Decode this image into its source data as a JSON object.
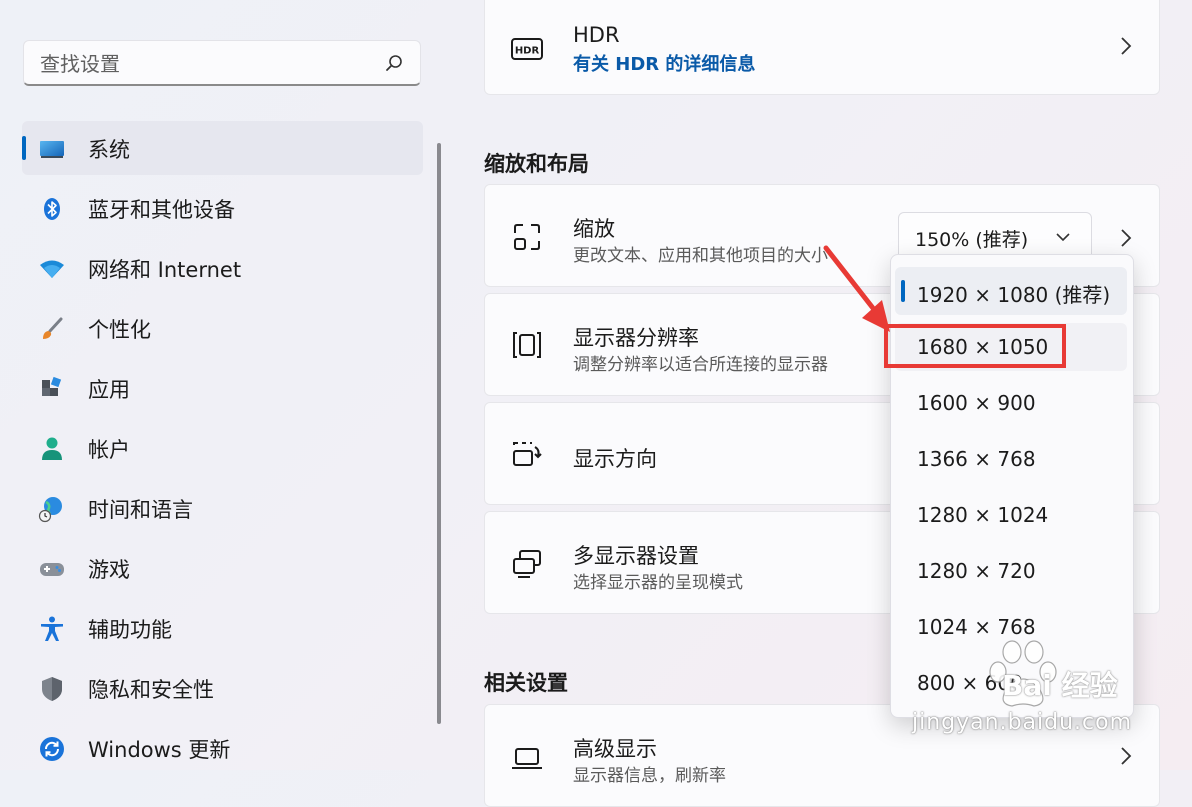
{
  "search": {
    "placeholder": "查找设置"
  },
  "sidebar": {
    "items": [
      {
        "label": "系统",
        "icon": "monitor-icon"
      },
      {
        "label": "蓝牙和其他设备",
        "icon": "bluetooth-icon"
      },
      {
        "label": "网络和 Internet",
        "icon": "wifi-icon"
      },
      {
        "label": "个性化",
        "icon": "brush-icon"
      },
      {
        "label": "应用",
        "icon": "apps-icon"
      },
      {
        "label": "帐户",
        "icon": "account-icon"
      },
      {
        "label": "时间和语言",
        "icon": "globe-clock-icon"
      },
      {
        "label": "游戏",
        "icon": "gamepad-icon"
      },
      {
        "label": "辅助功能",
        "icon": "accessibility-icon"
      },
      {
        "label": "隐私和安全性",
        "icon": "shield-icon"
      },
      {
        "label": "Windows 更新",
        "icon": "update-icon"
      }
    ]
  },
  "hdr": {
    "title": "HDR",
    "link": "有关 HDR 的详细信息",
    "icon": "hdr-icon"
  },
  "section_scale": "缩放和布局",
  "scale": {
    "title": "缩放",
    "subtitle": "更改文本、应用和其他项目的大小",
    "value": "150% (推荐)"
  },
  "resolution": {
    "title": "显示器分辨率",
    "subtitle": "调整分辨率以适合所连接的显示器"
  },
  "orientation": {
    "title": "显示方向"
  },
  "multi": {
    "title": "多显示器设置",
    "subtitle": "选择显示器的呈现模式"
  },
  "section_related": "相关设置",
  "advanced": {
    "title": "高级显示",
    "subtitle": "显示器信息，刷新率"
  },
  "resolution_options": [
    "1920 × 1080 (推荐)",
    "1680 × 1050",
    "1600 × 900",
    "1366 × 768",
    "1280 × 1024",
    "1280 × 720",
    "1024 × 768",
    "800 × 600"
  ],
  "watermark": {
    "text": "Bai 经验",
    "url": "jingyan.baidu.com"
  },
  "colors": {
    "accent": "#0067c0",
    "highlight": "#e83a35"
  }
}
